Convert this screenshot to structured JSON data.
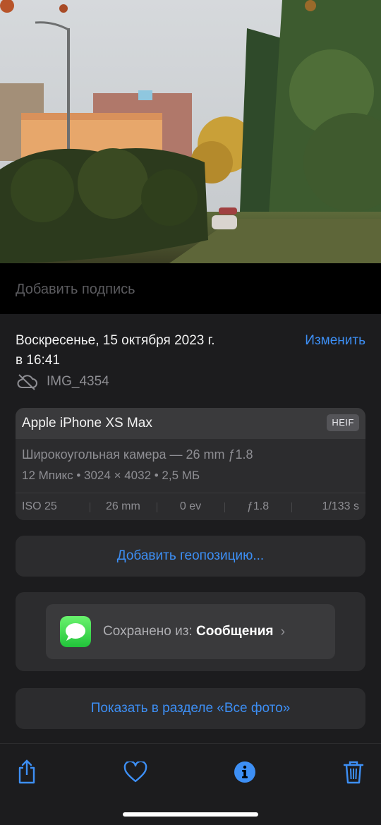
{
  "photo": {
    "description_icon": "photo-image"
  },
  "caption": {
    "placeholder": "Добавить подпись"
  },
  "info": {
    "date_line1": "Воскресенье, 15 октября 2023 г.",
    "date_line2": "в 16:41",
    "edit_label": "Изменить",
    "filename": "IMG_4354"
  },
  "exif": {
    "device": "Apple iPhone XS Max",
    "format_badge": "HEIF",
    "lens": "Широкоугольная камера — 26 mm ƒ1.8",
    "specs": "12 Мпикс  •  3024 × 4032  •  2,5 МБ",
    "cells": [
      "ISO 25",
      "26 mm",
      "0 ev",
      "ƒ1.8",
      "1/133 s"
    ]
  },
  "location": {
    "add_label": "Добавить геопозицию..."
  },
  "saved_from": {
    "prefix": "Сохранено из:",
    "app": "Сообщения"
  },
  "show_all": {
    "label": "Показать в разделе «Все фото»"
  },
  "toolbar": {
    "icons": [
      "share-icon",
      "heart-icon",
      "info-icon",
      "trash-icon"
    ]
  },
  "colors": {
    "accent": "#3d8ff5",
    "background": "#1c1c1e",
    "card": "#2c2c2e"
  }
}
